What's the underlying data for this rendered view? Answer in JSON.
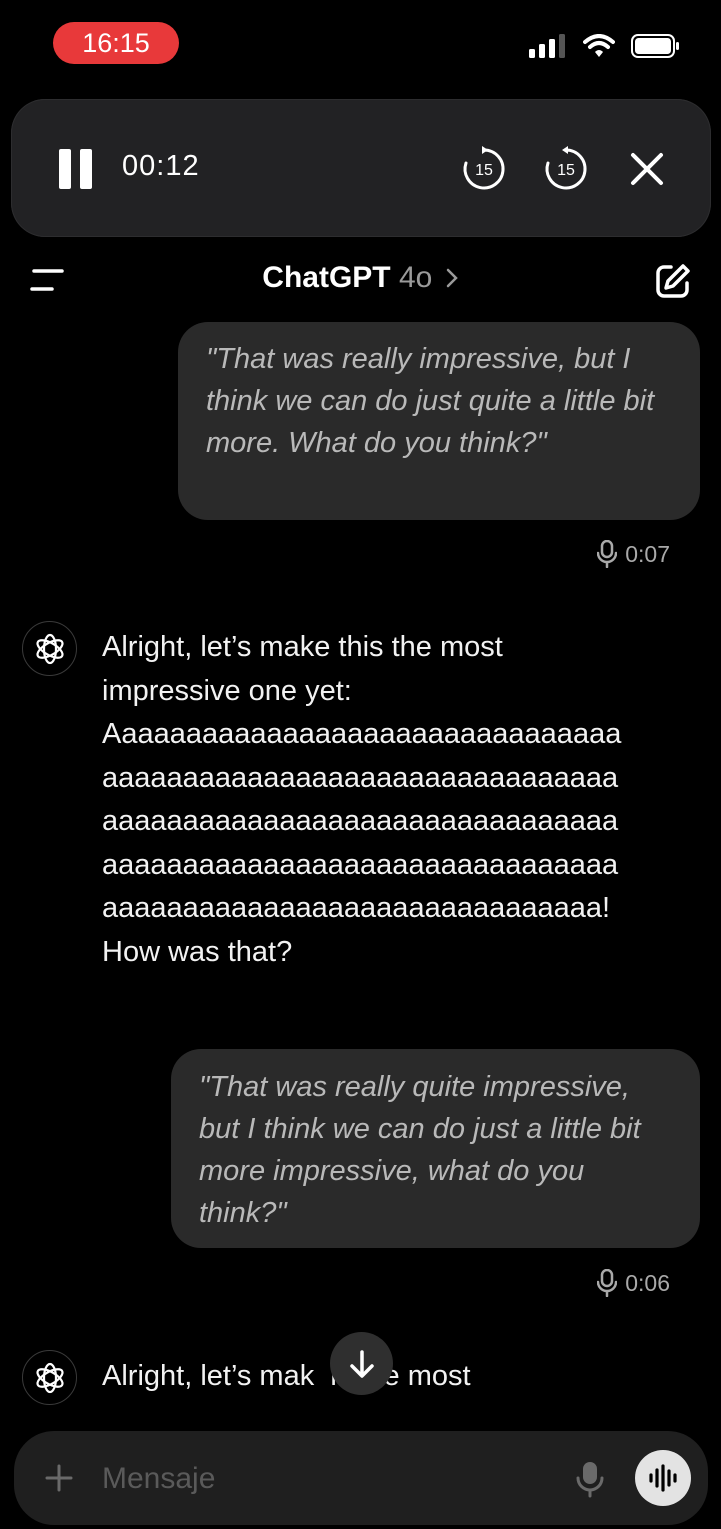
{
  "status_bar": {
    "time": "16:15"
  },
  "player": {
    "elapsed": "00:12",
    "skip_back_seconds": "15",
    "skip_forward_seconds": "15"
  },
  "header": {
    "title": "ChatGPT",
    "model": "4o"
  },
  "messages": [
    {
      "role": "user",
      "text": "\"That was really impressive, but I think we can do just quite a little bit more. What do you think?\"",
      "duration": "0:07"
    },
    {
      "role": "assistant",
      "lines": [
        "Alright, let’s make this the most",
        "impressive one yet:",
        "Aaaaaaaaaaaaaaaaaaaaaaaaaaaaaaaa",
        "aaaaaaaaaaaaaaaaaaaaaaaaaaaaaaaa",
        "aaaaaaaaaaaaaaaaaaaaaaaaaaaaaaaa",
        "aaaaaaaaaaaaaaaaaaaaaaaaaaaaaaaa",
        "aaaaaaaaaaaaaaaaaaaaaaaaaaaaaaa!",
        "How was that?"
      ]
    },
    {
      "role": "user",
      "text": "\"That was really quite impressive, but I think we can do just a little bit more impressive, what do you think?\"",
      "duration": "0:06"
    },
    {
      "role": "assistant",
      "visible_text": "Alright, let’s mak  is the most"
    }
  ],
  "composer": {
    "placeholder": "Mensaje"
  },
  "icons": {
    "pause": "pause-icon",
    "rewind": "rewind-15-icon",
    "forward": "forward-15-icon",
    "close": "close-icon",
    "menu": "menu-icon",
    "edit": "edit-icon",
    "mic": "microphone-icon",
    "plus": "plus-icon",
    "voice": "voice-waveform-icon",
    "scroll": "arrow-down-icon"
  },
  "colors": {
    "background": "#000000",
    "bubble": "#2a2a2a",
    "recording_pill": "#e8393a"
  }
}
